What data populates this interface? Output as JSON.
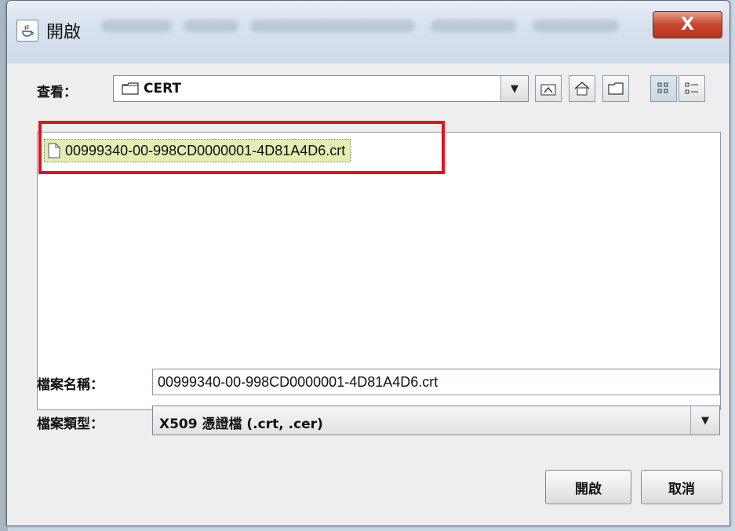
{
  "window": {
    "title": "開啟",
    "close_label": "X"
  },
  "look_in": {
    "label": "查看：",
    "value": "CERT"
  },
  "toolbar": {
    "buttons": [
      {
        "name": "up-one-level-button",
        "icon": "folder-up-icon"
      },
      {
        "name": "home-button",
        "icon": "home-icon"
      },
      {
        "name": "new-folder-button",
        "icon": "new-folder-icon"
      },
      {
        "name": "list-view-button",
        "icon": "list-view-icon",
        "active": true
      },
      {
        "name": "details-view-button",
        "icon": "details-view-icon"
      }
    ]
  },
  "files": [
    {
      "name": "00999340-00-998CD0000001-4D81A4D6.crt",
      "selected": true
    }
  ],
  "file_name": {
    "label": "檔案名稱：",
    "value": "00999340-00-998CD0000001-4D81A4D6.crt"
  },
  "file_type": {
    "label": "檔案類型：",
    "value": "X509 憑證檔 (.crt, .cer)"
  },
  "buttons": {
    "open": "開啟",
    "cancel": "取消"
  },
  "colors": {
    "highlight": "#e0121a",
    "selection": "#e4edb4",
    "close": "#c8472f"
  }
}
